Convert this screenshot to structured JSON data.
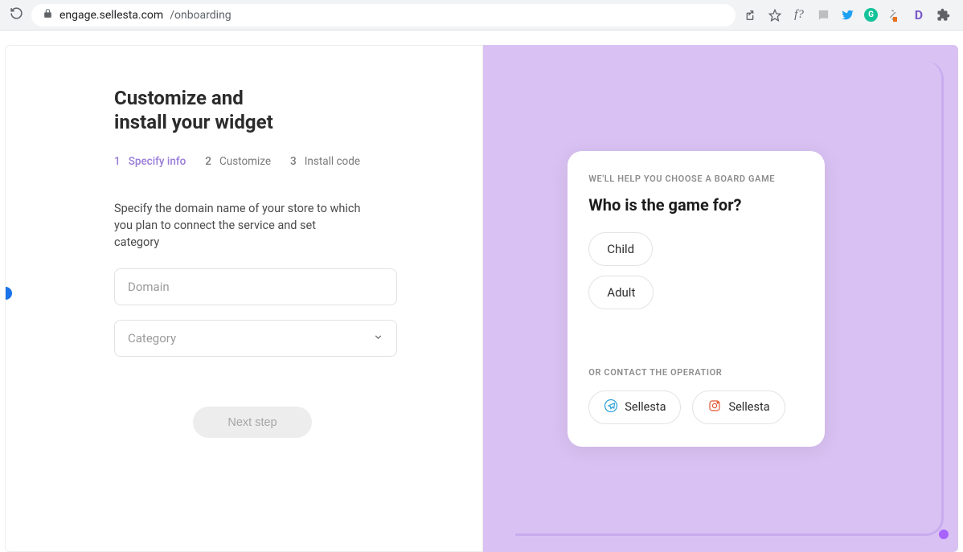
{
  "browser": {
    "url_host": "engage.sellesta.com",
    "url_path": "/onboarding"
  },
  "page": {
    "title_line1": "Customize and",
    "title_line2": "install your widget",
    "steps": [
      {
        "num": "1",
        "label": "Specify info",
        "active": true
      },
      {
        "num": "2",
        "label": "Customize",
        "active": false
      },
      {
        "num": "3",
        "label": "Install code",
        "active": false
      }
    ],
    "description": "Specify the domain name of your store to which you plan to connect the service and set category",
    "domain_placeholder": "Domain",
    "category_placeholder": "Category",
    "next_button": "Next step"
  },
  "widget": {
    "caption": "WE'LL HELP YOU CHOOSE A BOARD GAME",
    "question": "Who is the game for?",
    "options": [
      "Child",
      "Adult"
    ],
    "contact_caption": "OR CONTACT THE OPERATIOR",
    "contacts": [
      {
        "icon": "telegram",
        "label": "Sellesta"
      },
      {
        "icon": "instagram",
        "label": "Sellesta"
      }
    ]
  }
}
